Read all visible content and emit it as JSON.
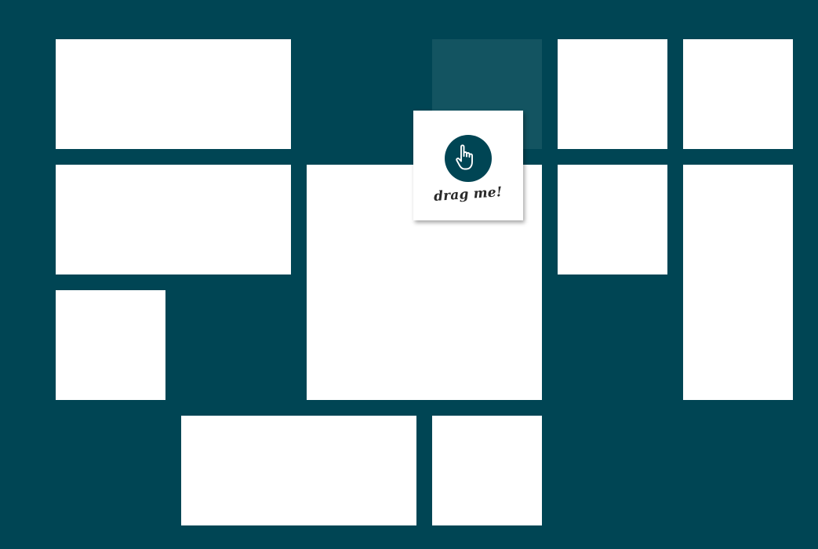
{
  "colors": {
    "background": "#004554",
    "tile": "#ffffff",
    "placeholder": "#135461",
    "icon_circle": "#004554",
    "icon_stroke": "#ffffff",
    "label_text": "#2a2a2a"
  },
  "drag_item": {
    "label": "drag me!",
    "icon": "pointing-hand-icon"
  },
  "tiles": [
    {
      "name": "tile-1"
    },
    {
      "name": "tile-2"
    },
    {
      "name": "tile-3"
    },
    {
      "name": "tile-4"
    },
    {
      "name": "tile-5"
    },
    {
      "name": "tile-6"
    },
    {
      "name": "tile-7"
    },
    {
      "name": "tile-8"
    },
    {
      "name": "tile-9"
    },
    {
      "name": "tile-10"
    }
  ]
}
